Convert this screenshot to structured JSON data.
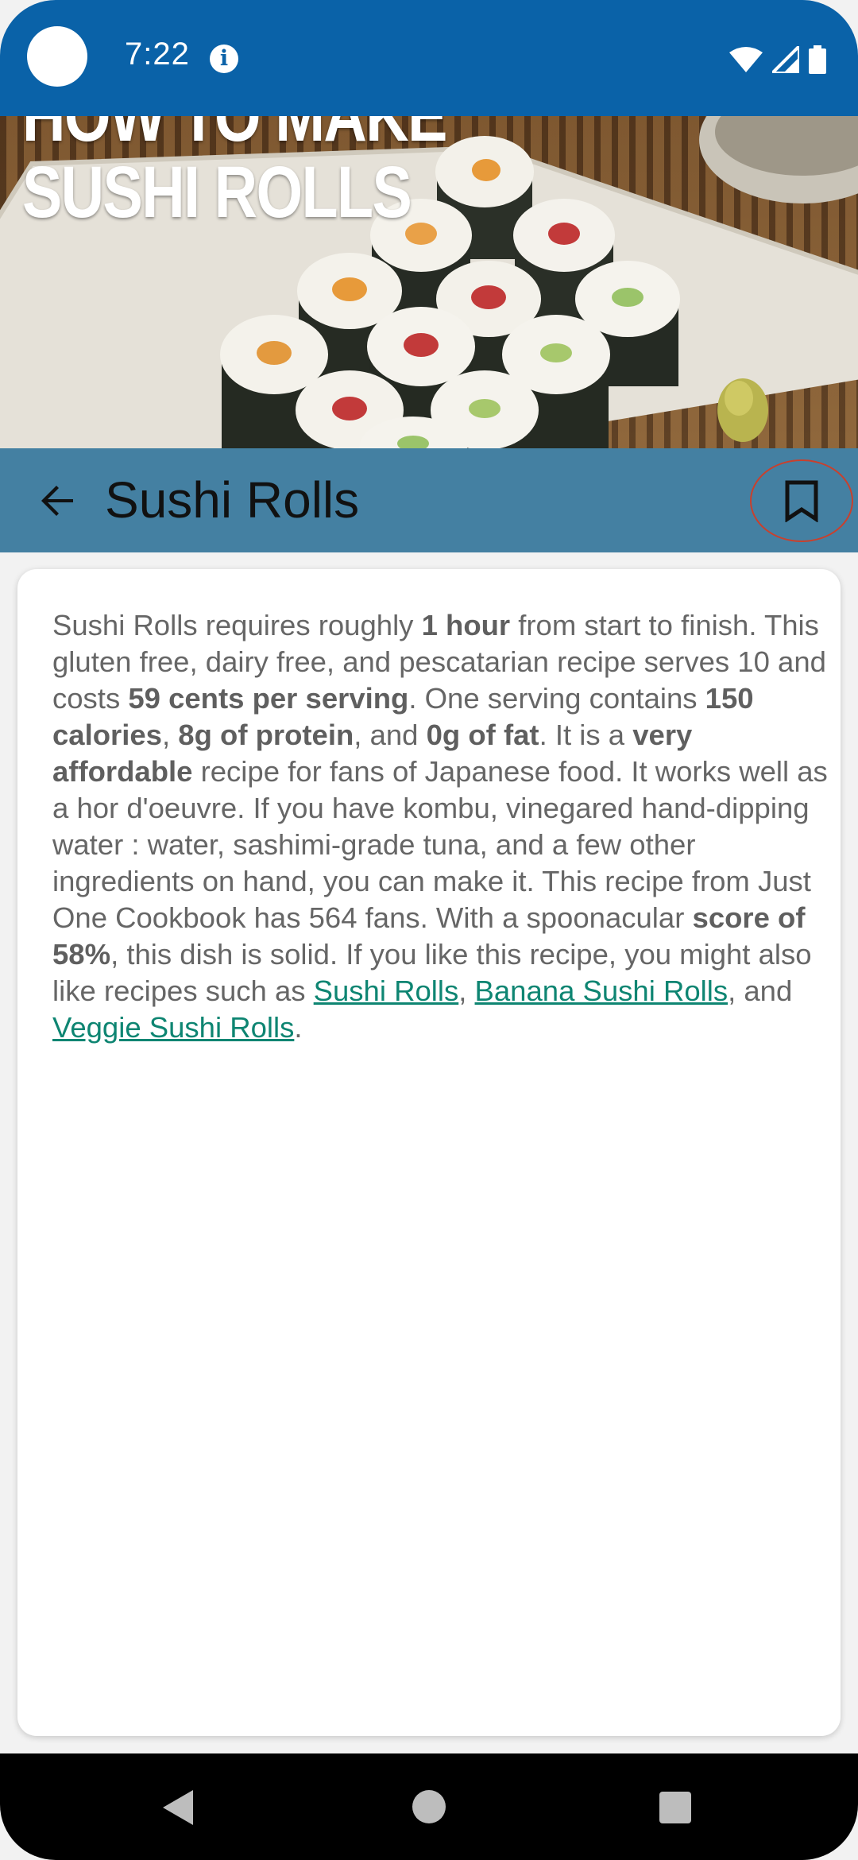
{
  "status_bar": {
    "time": "7:22",
    "icons": [
      "info-icon",
      "wifi-icon",
      "cell-signal-icon",
      "battery-icon"
    ]
  },
  "hero": {
    "title_line1": "HOW TO MAKE",
    "title_line2": "SUSHI ROLLS"
  },
  "toolbar": {
    "title": "Sushi Rolls",
    "back_icon": "arrow-back-icon",
    "bookmark_icon": "bookmark-icon",
    "background": "#4480a2"
  },
  "summary": {
    "segments": [
      {
        "t": "Sushi Rolls requires roughly "
      },
      {
        "t": "1 hour",
        "b": true
      },
      {
        "t": " from start to finish. This gluten free, dairy free, and pescatarian recipe serves 10 and costs "
      },
      {
        "t": "59 cents per serving",
        "b": true
      },
      {
        "t": ". One serving contains "
      },
      {
        "t": "150 calories",
        "b": true
      },
      {
        "t": ", "
      },
      {
        "t": "8g of protein",
        "b": true
      },
      {
        "t": ", and "
      },
      {
        "t": "0g of fat",
        "b": true
      },
      {
        "t": ". It is a "
      },
      {
        "t": "very affordable",
        "b": true
      },
      {
        "t": " recipe for fans of Japanese food. It works well as a hor d'oeuvre. If you have kombu, vinegared hand-dipping water : water, sashimi-grade tuna, and a few other ingredients on hand, you can make it. This recipe from Just One Cookbook has 564 fans. With a spoonacular "
      },
      {
        "t": "score of 58%",
        "b": true
      },
      {
        "t": ", this dish is solid. If you like this recipe, you might also like recipes such as "
      },
      {
        "t": "Sushi Rolls",
        "link": true
      },
      {
        "t": ", "
      },
      {
        "t": "Banana Sushi Rolls",
        "link": true
      },
      {
        "t": ", and "
      },
      {
        "t": "Veggie Sushi Rolls",
        "link": true
      },
      {
        "t": "."
      }
    ],
    "link_color": "#0e8572"
  },
  "nav_bar": {
    "icons": [
      "nav-back-icon",
      "nav-home-icon",
      "nav-recents-icon"
    ]
  }
}
